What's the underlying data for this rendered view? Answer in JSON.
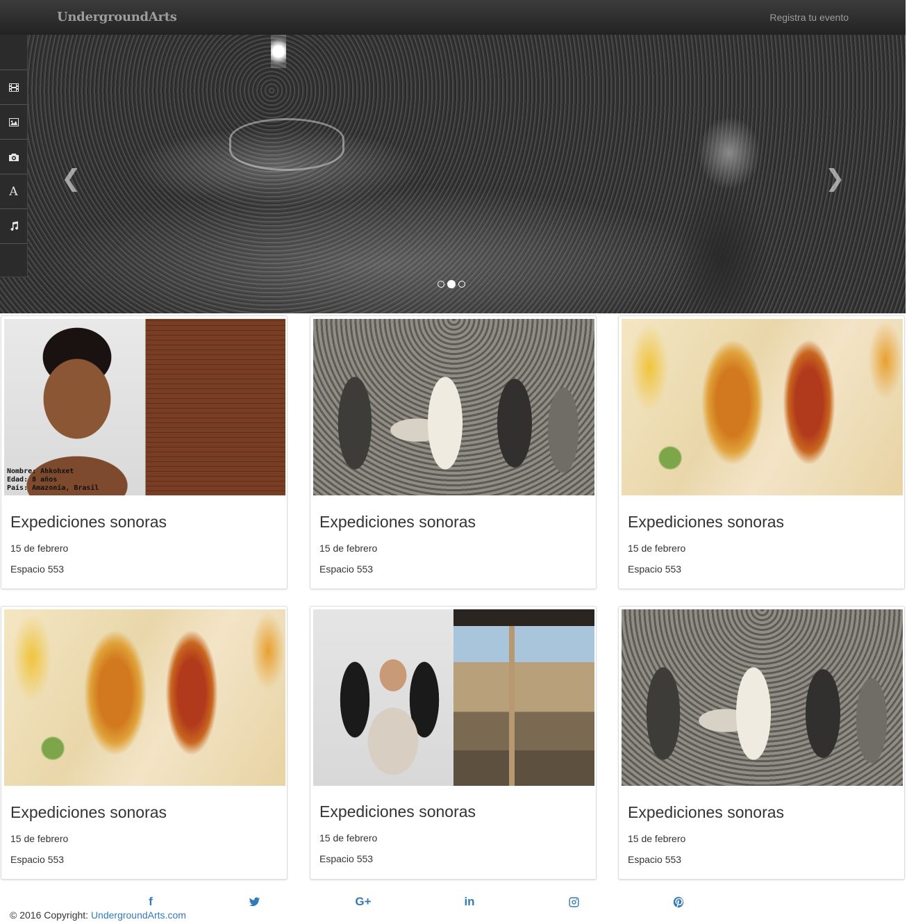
{
  "navbar": {
    "brand": "UndergroundArts",
    "register_link": "Registra tu evento"
  },
  "hero": {
    "prev_icon": "chevron-left-icon",
    "next_icon": "chevron-right-icon",
    "slide_count": 3,
    "active_slide": 2
  },
  "sidebar": {
    "items": [
      {
        "icon": "film-icon"
      },
      {
        "icon": "image-icon"
      },
      {
        "icon": "camera-icon"
      },
      {
        "icon": "font-icon",
        "glyph": "A"
      },
      {
        "icon": "music-icon"
      }
    ]
  },
  "events": [
    {
      "title": "Expediciones sonoras",
      "date": "15 de febrero",
      "venue": "Espacio 553"
    },
    {
      "title": "Expediciones sonoras",
      "date": "15 de febrero",
      "venue": "Espacio 553"
    },
    {
      "title": "Expediciones sonoras",
      "date": "15 de febrero",
      "venue": "Espacio 553"
    },
    {
      "title": "Expediciones sonoras",
      "date": "15 de febrero",
      "venue": "Espacio 553"
    },
    {
      "title": "Expediciones sonoras",
      "date": "15 de febrero",
      "venue": "Espacio 553"
    },
    {
      "title": "Expediciones sonoras",
      "date": "15 de febrero",
      "venue": "Espacio 553"
    }
  ],
  "card1_caption": {
    "line1": "Nombre: Ahkohxet",
    "line2": "Edad: 8 años",
    "line3": "País: Amazonía, Brasil"
  },
  "footer": {
    "social": [
      {
        "icon": "facebook-icon",
        "glyph": "f"
      },
      {
        "icon": "twitter-icon"
      },
      {
        "icon": "google-plus-icon",
        "glyph": "G+"
      },
      {
        "icon": "linkedin-icon",
        "glyph": "in"
      },
      {
        "icon": "instagram-icon"
      },
      {
        "icon": "pinterest-icon"
      }
    ],
    "copyright_prefix": "© 2016 Copyright:",
    "copyright_link": "UndergroundArts.com"
  },
  "colors": {
    "link": "#337ab7",
    "navbar_text": "#9d9d9d",
    "navbar_bg": "#222222"
  }
}
